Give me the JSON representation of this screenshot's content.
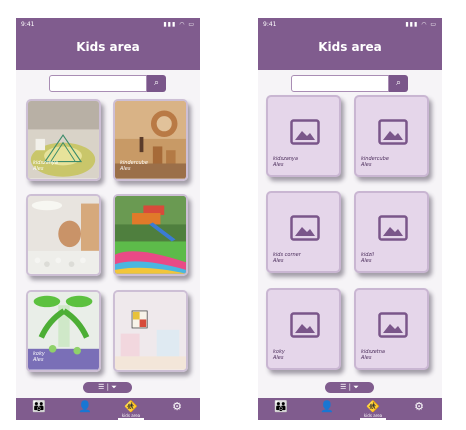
{
  "status": {
    "time": "9:41",
    "icons": "signal-icon wifi-icon battery-icon"
  },
  "header": {
    "title": "Kids area"
  },
  "search": {
    "placeholder": "",
    "button_icon": "search-icon"
  },
  "left_screen": {
    "cards": [
      {
        "title": "kidszanya",
        "subtitle": "Ales",
        "scene": "indoor play area with climbing net"
      },
      {
        "title": "kindercube",
        "subtitle": "Ales",
        "scene": "wooden play room"
      },
      {
        "title": "",
        "subtitle": "",
        "scene": "ball pit play room"
      },
      {
        "title": "",
        "subtitle": "",
        "scene": "outdoor playground"
      },
      {
        "title": "koky",
        "subtitle": "Ales",
        "scene": "green tree play room"
      },
      {
        "title": "",
        "subtitle": "",
        "scene": "pastel play room"
      }
    ]
  },
  "right_screen": {
    "cards": [
      {
        "title": "kidszanya",
        "subtitle": "Ales"
      },
      {
        "title": "kindercube",
        "subtitle": "Ales"
      },
      {
        "title": "kids corner",
        "subtitle": "Ales"
      },
      {
        "title": "kidzil",
        "subtitle": "Ales"
      },
      {
        "title": "koky",
        "subtitle": "Ales"
      },
      {
        "title": "kidszetna",
        "subtitle": "Ales"
      }
    ]
  },
  "filter": {
    "list_icon": "list-icon",
    "filter_icon": "filter-icon"
  },
  "nav": {
    "items": [
      {
        "icon": "group-icon",
        "label": ""
      },
      {
        "icon": "profile-icon",
        "label": ""
      },
      {
        "icon": "kids-icon",
        "label": "kids area",
        "active": true
      },
      {
        "icon": "settings-icon",
        "label": ""
      }
    ]
  },
  "colors": {
    "primary": "#805c8e",
    "card_placeholder": "#e5d6ea",
    "background": "#f6f4f7"
  }
}
